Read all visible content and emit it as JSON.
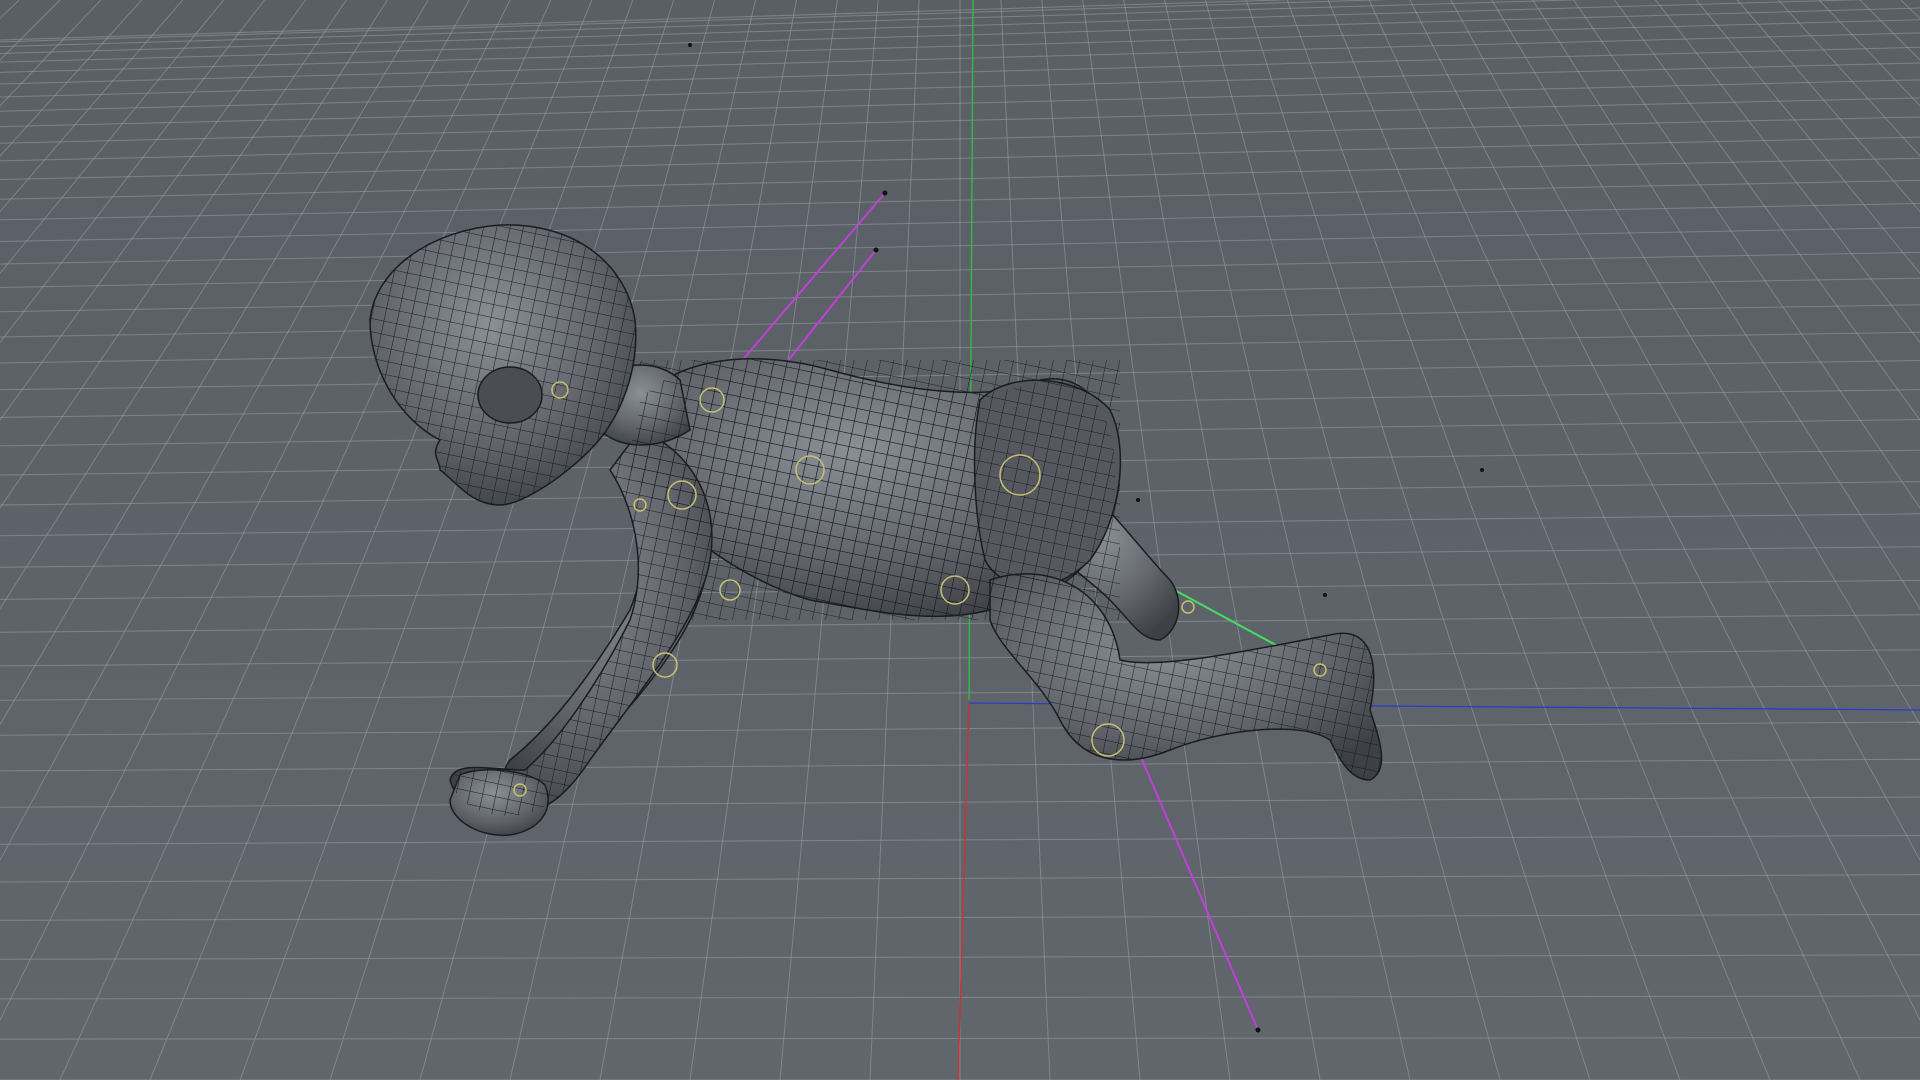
{
  "viewport": {
    "view": "perspective",
    "shading": "wireframe-on-shaded",
    "subject": "crawling-baby-mesh",
    "grid_visible": true
  },
  "colors": {
    "background": "#5d6269",
    "grid": "#9aa0a8",
    "mesh_fill": "#5b5f64",
    "mesh_wire": "#1a1c1f",
    "x_axis": "#d23030",
    "y_axis": "#30c040",
    "z_axis": "#2a3cc8",
    "joint_handles": "#c8c070",
    "ik_lines": "#c040d8",
    "ik_green": "#40e060"
  },
  "scene_items": [
    {
      "name": "baby-mesh",
      "type": "mesh"
    },
    {
      "name": "rig-joints",
      "type": "joints"
    },
    {
      "name": "ik-handles",
      "type": "ik"
    }
  ]
}
